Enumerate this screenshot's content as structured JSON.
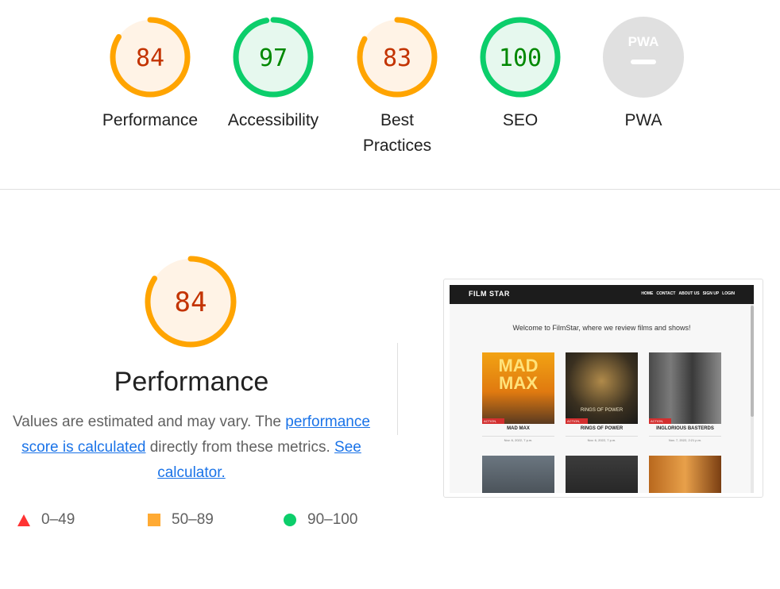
{
  "gauges": [
    {
      "score": "84",
      "label": "Performance",
      "value": 84,
      "status": "average"
    },
    {
      "score": "97",
      "label": "Accessibility",
      "value": 97,
      "status": "pass"
    },
    {
      "score": "83",
      "label_line1": "Best",
      "label_line2": "Practices",
      "value": 83,
      "status": "average"
    },
    {
      "score": "100",
      "label": "SEO",
      "value": 100,
      "status": "pass"
    },
    {
      "badge": "PWA",
      "label": "PWA",
      "status": "na"
    }
  ],
  "performance": {
    "score": "84",
    "value": 84,
    "title": "Performance",
    "desc_before": "Values are estimated and may vary. The ",
    "desc_link": "performance score is calculated",
    "desc_after": " directly from these metrics. ",
    "calc_link": "See calculator."
  },
  "legend": [
    {
      "range": "0–49",
      "shape": "triangle",
      "color": "#ff3333"
    },
    {
      "range": "50–89",
      "shape": "square",
      "color": "#ffaa33"
    },
    {
      "range": "90–100",
      "shape": "circle",
      "color": "#0cce6b"
    }
  ],
  "screenshot": {
    "brand": "FILM STAR",
    "nav_links": [
      "HOME",
      "CONTACT",
      "ABOUT US",
      "SIGN UP",
      "LOGIN"
    ],
    "welcome": "Welcome to FilmStar, where we review films and shows!",
    "posters": [
      {
        "title": "MAD MAX",
        "date": "Nov. 6, 2022, 7 p.m.",
        "art": "MAD MAX",
        "tag": "ACTION, DRAMA"
      },
      {
        "title": "RINGS OF POWER",
        "date": "Nov. 6, 2022, 7 p.m.",
        "art": "RINGS OF POWER",
        "tag": "ACTION, DRAMA"
      },
      {
        "title": "INGLORIOUS BASTERDS",
        "date": "Nov. 7, 2022, 2:21 p.m.",
        "art": "",
        "tag": "ACTION, DRAMA"
      }
    ]
  },
  "colors": {
    "average_stroke": "#ffa400",
    "average_fill": "#fff3e6",
    "average_text": "#c33300",
    "pass_stroke": "#0cce6b",
    "pass_fill": "#e6f8ee",
    "pass_text": "#008800",
    "na_fill": "#e0e0e0",
    "link": "#1a73e8"
  }
}
